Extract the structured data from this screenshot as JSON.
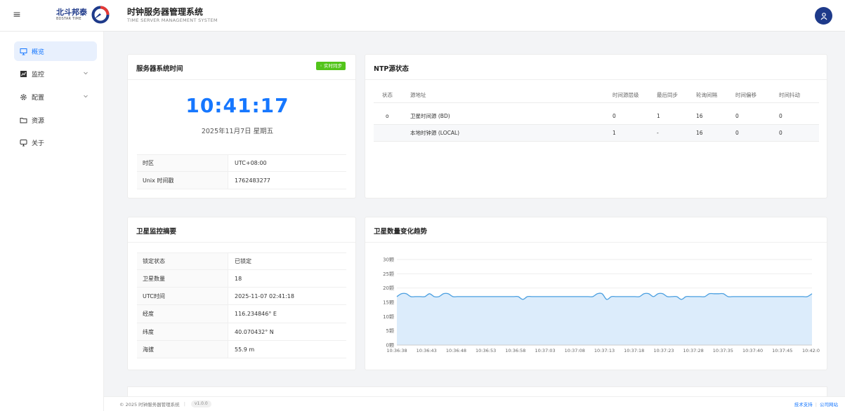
{
  "header": {
    "brand_cn": "北斗邦泰",
    "brand_en": "BDSTAR TIME",
    "title": "时钟服务器管理系统",
    "subtitle": "TIME SERVER MANAGEMENT SYSTEM"
  },
  "sidebar": {
    "items": [
      {
        "label": "概览",
        "icon": "monitor-icon",
        "active": true
      },
      {
        "label": "监控",
        "icon": "chart-icon",
        "expandable": true
      },
      {
        "label": "配置",
        "icon": "gear-icon",
        "expandable": true
      },
      {
        "label": "资源",
        "icon": "folder-icon"
      },
      {
        "label": "关于",
        "icon": "info-screen-icon"
      }
    ]
  },
  "server_time": {
    "title": "服务器系统时间",
    "sync_badge": "实时同步",
    "time": "10:41:17",
    "date": "2025年11月7日  星期五",
    "rows": [
      {
        "label": "时区",
        "value": "UTC+08:00"
      },
      {
        "label": "Unix 时间戳",
        "value": "1762483277"
      }
    ]
  },
  "ntp": {
    "title": "NTP源状态",
    "columns": [
      "状态",
      "源地址",
      "时间源层级",
      "最后同步",
      "轮询间隔",
      "时间偏移",
      "时间抖动"
    ],
    "rows": [
      {
        "status": "o",
        "address": "卫星时间源 (BD)",
        "stratum": "0",
        "last_sync": "1",
        "poll": "16",
        "offset": "0",
        "jitter": "0"
      },
      {
        "status": "",
        "address": "本地时钟源 (LOCAL)",
        "stratum": "1",
        "last_sync": "-",
        "poll": "16",
        "offset": "0",
        "jitter": "0"
      }
    ]
  },
  "satellite_summary": {
    "title": "卫星监控摘要",
    "rows": [
      {
        "label": "锁定状态",
        "value": "已锁定"
      },
      {
        "label": "卫星数量",
        "value": "18"
      },
      {
        "label": "UTC时间",
        "value": "2025-11-07 02:41:18"
      },
      {
        "label": "经度",
        "value": "116.234846° E"
      },
      {
        "label": "纬度",
        "value": "40.070432° N"
      },
      {
        "label": "海拔",
        "value": "55.9 m"
      }
    ]
  },
  "chart_panel": {
    "title": "卫星数量变化趋势"
  },
  "chart_data": {
    "type": "area",
    "title": "卫星数量变化趋势",
    "ylim": [
      0,
      30
    ],
    "y_ticks": [
      "0颗",
      "5颗",
      "10颗",
      "15颗",
      "20颗",
      "25颗",
      "30颗"
    ],
    "x_ticks": [
      "10:36:38",
      "10:36:43",
      "10:36:48",
      "10:36:53",
      "10:36:58",
      "10:37:03",
      "10:37:08",
      "10:37:13",
      "10:37:18",
      "10:37:23",
      "10:37:28",
      "10:37:35",
      "10:37:40",
      "10:37:45",
      "10:42:0"
    ],
    "values": [
      17,
      18,
      18,
      17,
      17,
      17,
      17,
      18,
      17,
      17,
      18,
      18,
      17,
      17,
      17,
      17,
      17,
      17,
      17,
      17,
      17,
      17,
      17,
      17,
      17,
      17,
      17,
      16,
      17,
      17,
      17,
      17,
      17,
      17,
      17,
      17,
      17,
      17,
      17,
      17,
      17,
      17,
      17,
      18,
      18,
      16,
      17,
      17,
      17,
      17,
      17,
      17,
      17,
      18,
      18,
      17,
      18,
      18,
      17,
      17,
      17,
      16,
      17,
      17,
      17,
      17,
      17,
      18,
      18,
      18,
      18,
      17,
      17,
      17,
      17,
      17,
      17,
      17,
      17,
      17,
      17,
      17,
      17,
      17,
      17,
      17,
      17,
      17,
      17,
      18
    ],
    "line_color": "#4a9fe0",
    "fill_color": "#dcecfb",
    "grid": true
  },
  "footer": {
    "copyright": "© 2025 时钟服务器管理系统",
    "version": "v1.0.0",
    "links": [
      "技术支持",
      "公司网站"
    ]
  }
}
